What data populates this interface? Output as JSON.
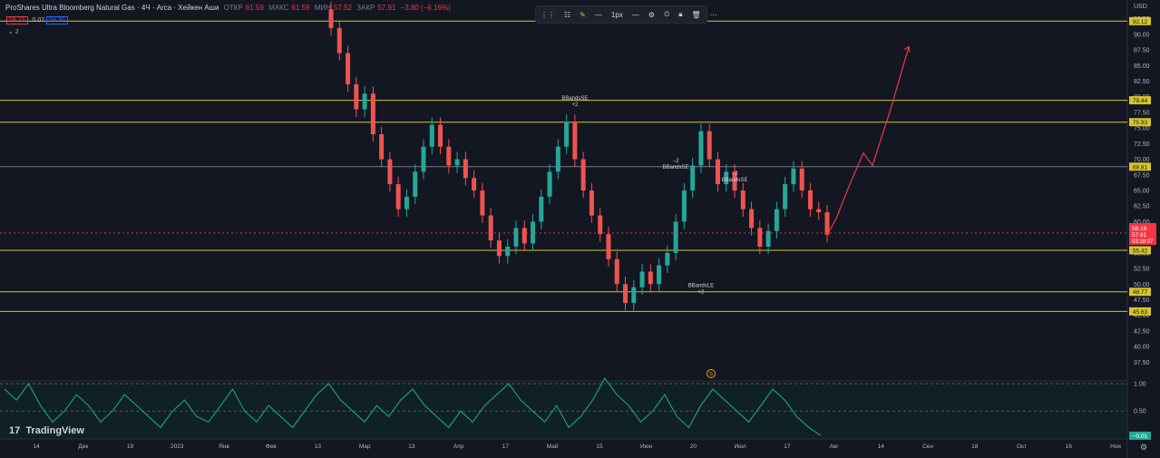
{
  "legend": {
    "title": "ProShares Ultra Bloomberg Natural Gas · 4Ч · Arca · Хейкен Аши",
    "open_label": "ОТКР",
    "open": "61.59",
    "high_label": "МАКС",
    "high": "61.59",
    "low_label": "МИН",
    "low": "57.52",
    "close_label": "ЗАКР",
    "close": "57.91",
    "change": "−3.80 (−6.16%)"
  },
  "price_tags": {
    "bid": "58.23",
    "spread": "0.07",
    "ask": "58.30"
  },
  "collapse_label": "⌄ 2",
  "toolbar": {
    "width_label": "1px"
  },
  "watermark": "TradingView",
  "currency": "USD",
  "colors": {
    "bg": "#131722",
    "up": "#26a69a",
    "down": "#ef5350",
    "level": "#d6c52b",
    "osc": "#22ab94",
    "arrow": "#f23645"
  },
  "chart_data": {
    "type": "candlestick",
    "price_axis": {
      "ticks": [
        "92.50",
        "90.00",
        "87.50",
        "85.00",
        "82.50",
        "80.00",
        "77.50",
        "75.00",
        "72.50",
        "70.00",
        "67.50",
        "65.00",
        "62.50",
        "60.00",
        "57.50",
        "55.00",
        "52.50",
        "50.00",
        "47.50",
        "45.00",
        "42.50",
        "40.00",
        "37.50"
      ],
      "range": [
        34.5,
        95.5
      ]
    },
    "osc_axis": {
      "ticks": [
        "1.00",
        "0.50"
      ],
      "range": [
        -0.01,
        1.05
      ]
    },
    "time_axis": [
      "14",
      "Дек",
      "19",
      "2023",
      "Янв",
      "Фев",
      "13",
      "Мар",
      "13",
      "Апр",
      "17",
      "Май",
      "15",
      "Июн",
      "20",
      "Июл",
      "17",
      "Авг",
      "14",
      "Сен",
      "18",
      "Окт",
      "16",
      "Ноя"
    ],
    "horizontal_levels": [
      {
        "price": 92.12,
        "label": "92.12",
        "style": "yellow"
      },
      {
        "price": 79.44,
        "label": "79.44",
        "style": "yellow"
      },
      {
        "price": 75.93,
        "label": "75.93",
        "style": "yellow"
      },
      {
        "price": 68.81,
        "label": "68.81",
        "style": "gray"
      },
      {
        "price": 55.42,
        "label": "55.42",
        "style": "yellow"
      },
      {
        "price": 48.77,
        "label": "48.77",
        "style": "yellow"
      },
      {
        "price": 45.63,
        "label": "45.63",
        "style": "yellow"
      }
    ],
    "current_price": {
      "price": 58.18,
      "label": "58.18",
      "sub_label": "57.91",
      "timer": "03:16:07"
    },
    "osc_last": {
      "label": "−0.01"
    },
    "annotations": [
      {
        "text": "BBandsSE",
        "sub": "+2",
        "x_index": 29,
        "price": 79.5
      },
      {
        "text": "−2",
        "sub": "BBandsSE",
        "x_index": 41,
        "price": 69.5
      },
      {
        "text": "BBandsLE",
        "sub": "+2",
        "x_index": 44,
        "price": 49.5
      },
      {
        "text": "−2",
        "sub": "BBandsSE",
        "x_index": 48,
        "price": 67.5
      }
    ],
    "event_badge": "S",
    "candles": [
      {
        "o": 94.0,
        "c": 91.0
      },
      {
        "o": 91.0,
        "c": 87.0
      },
      {
        "o": 87.0,
        "c": 82.0
      },
      {
        "o": 82.0,
        "c": 78.0
      },
      {
        "o": 78.0,
        "c": 80.5
      },
      {
        "o": 80.5,
        "c": 74.0
      },
      {
        "o": 74.0,
        "c": 70.0
      },
      {
        "o": 70.0,
        "c": 66.0
      },
      {
        "o": 66.0,
        "c": 62.0
      },
      {
        "o": 62.0,
        "c": 64.0
      },
      {
        "o": 64.0,
        "c": 68.0
      },
      {
        "o": 68.0,
        "c": 72.0
      },
      {
        "o": 72.0,
        "c": 75.5
      },
      {
        "o": 75.5,
        "c": 72.0
      },
      {
        "o": 72.0,
        "c": 69.0
      },
      {
        "o": 69.0,
        "c": 70.0
      },
      {
        "o": 70.0,
        "c": 67.0
      },
      {
        "o": 67.0,
        "c": 65.0
      },
      {
        "o": 65.0,
        "c": 61.0
      },
      {
        "o": 61.0,
        "c": 57.0
      },
      {
        "o": 57.0,
        "c": 54.5
      },
      {
        "o": 54.5,
        "c": 56.0
      },
      {
        "o": 56.0,
        "c": 59.0
      },
      {
        "o": 59.0,
        "c": 56.5
      },
      {
        "o": 56.5,
        "c": 60.0
      },
      {
        "o": 60.0,
        "c": 64.0
      },
      {
        "o": 64.0,
        "c": 68.0
      },
      {
        "o": 68.0,
        "c": 72.0
      },
      {
        "o": 72.0,
        "c": 76.0
      },
      {
        "o": 76.0,
        "c": 70.0
      },
      {
        "o": 70.0,
        "c": 65.0
      },
      {
        "o": 65.0,
        "c": 61.0
      },
      {
        "o": 61.0,
        "c": 58.0
      },
      {
        "o": 58.0,
        "c": 54.0
      },
      {
        "o": 54.0,
        "c": 50.0
      },
      {
        "o": 50.0,
        "c": 47.0
      },
      {
        "o": 47.0,
        "c": 49.5
      },
      {
        "o": 49.5,
        "c": 52.0
      },
      {
        "o": 52.0,
        "c": 50.0
      },
      {
        "o": 50.0,
        "c": 53.0
      },
      {
        "o": 53.0,
        "c": 55.0
      },
      {
        "o": 55.0,
        "c": 60.0
      },
      {
        "o": 60.0,
        "c": 65.0
      },
      {
        "o": 65.0,
        "c": 69.0
      },
      {
        "o": 69.0,
        "c": 74.5
      },
      {
        "o": 74.5,
        "c": 70.0
      },
      {
        "o": 70.0,
        "c": 66.0
      },
      {
        "o": 66.0,
        "c": 68.0
      },
      {
        "o": 68.0,
        "c": 65.0
      },
      {
        "o": 65.0,
        "c": 62.0
      },
      {
        "o": 62.0,
        "c": 59.0
      },
      {
        "o": 59.0,
        "c": 56.0
      },
      {
        "o": 56.0,
        "c": 58.5
      },
      {
        "o": 58.5,
        "c": 62.0
      },
      {
        "o": 62.0,
        "c": 66.0
      },
      {
        "o": 66.0,
        "c": 68.5
      },
      {
        "o": 68.5,
        "c": 65.0
      },
      {
        "o": 65.0,
        "c": 62.0
      },
      {
        "o": 62.0,
        "c": 61.5
      },
      {
        "o": 61.5,
        "c": 57.9
      }
    ],
    "oscillator": [
      0.9,
      0.7,
      1.0,
      0.6,
      0.3,
      0.5,
      0.8,
      0.6,
      0.3,
      0.5,
      0.8,
      0.6,
      0.4,
      0.2,
      0.5,
      0.7,
      0.4,
      0.3,
      0.6,
      0.9,
      0.5,
      0.3,
      0.6,
      0.4,
      0.2,
      0.5,
      0.8,
      1.0,
      0.7,
      0.5,
      0.3,
      0.6,
      0.4,
      0.7,
      0.9,
      0.6,
      0.4,
      0.2,
      0.5,
      0.3,
      0.6,
      0.8,
      1.0,
      0.7,
      0.5,
      0.3,
      0.6,
      0.2,
      0.4,
      0.7,
      1.1,
      0.8,
      0.6,
      0.3,
      0.5,
      0.8,
      0.4,
      0.2,
      0.6,
      0.9,
      0.7,
      0.5,
      0.3,
      0.6,
      0.9,
      0.7,
      0.4,
      0.2,
      0.05
    ],
    "forecast_arrow": [
      [
        57.9,
        0
      ],
      [
        60.5,
        2
      ],
      [
        66,
        5
      ],
      [
        71,
        8
      ],
      [
        69,
        10
      ],
      [
        78,
        14
      ],
      [
        88,
        18
      ]
    ]
  }
}
